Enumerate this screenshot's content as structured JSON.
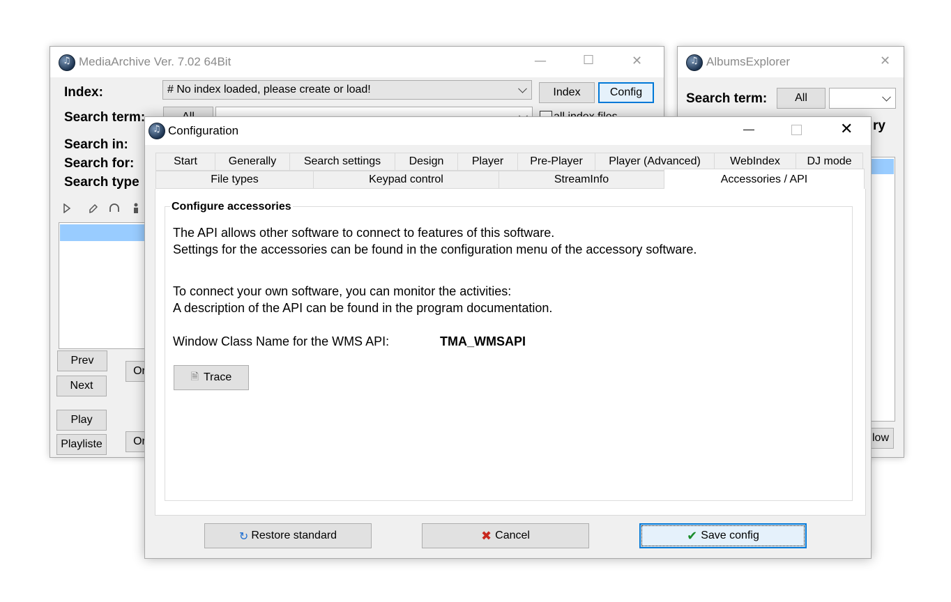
{
  "media_archive": {
    "title": "MediaArchive Ver. 7.02 64Bit",
    "index_label": "Index:",
    "index_value": "# No index loaded, please create or load!",
    "index_button": "Index",
    "config_button": "Config",
    "search_term_label": "Search term:",
    "all_button": "All",
    "all_index_files": "all index files",
    "search_in_label": "Search in:",
    "search_for_label": "Search for:",
    "search_type_label": "Search type",
    "prev_button": "Prev",
    "next_button": "Next",
    "play_button": "Play",
    "playlist_button": "Playliste",
    "or_button_1": "Or",
    "or_button_2": "Or"
  },
  "albums_explorer": {
    "title": "AlbumsExplorer",
    "search_term_label": "Search term:",
    "all_button": "All",
    "partial_label": "ry",
    "show_button": "llow"
  },
  "config": {
    "title": "Configuration",
    "tabs_row1": [
      "Start",
      "Generally",
      "Search settings",
      "Design",
      "Player",
      "Pre-Player",
      "Player (Advanced)",
      "WebIndex",
      "DJ mode"
    ],
    "tabs_row2": [
      "File types",
      "Keypad control",
      "StreamInfo",
      "Accessories / API"
    ],
    "group_title": "Configure accessories",
    "line1": "The API allows other software to connect to features of this software.",
    "line2": "Settings for the accessories can be found in the configuration menu of the accessory software.",
    "line3": "To connect your own software, you can monitor the activities:",
    "line4": "A description of the API can be found in the program documentation.",
    "class_name_label": "Window Class Name for the WMS API:",
    "class_name_value": "TMA_WMSAPI",
    "trace_button": "Trace",
    "restore_button": "Restore standard",
    "cancel_button": "Cancel",
    "save_button": "Save config"
  },
  "colors": {
    "selection": "#99ccff",
    "save_border": "#0078d7",
    "cancel_x": "#c8281e",
    "save_check": "#1a8c2a"
  }
}
